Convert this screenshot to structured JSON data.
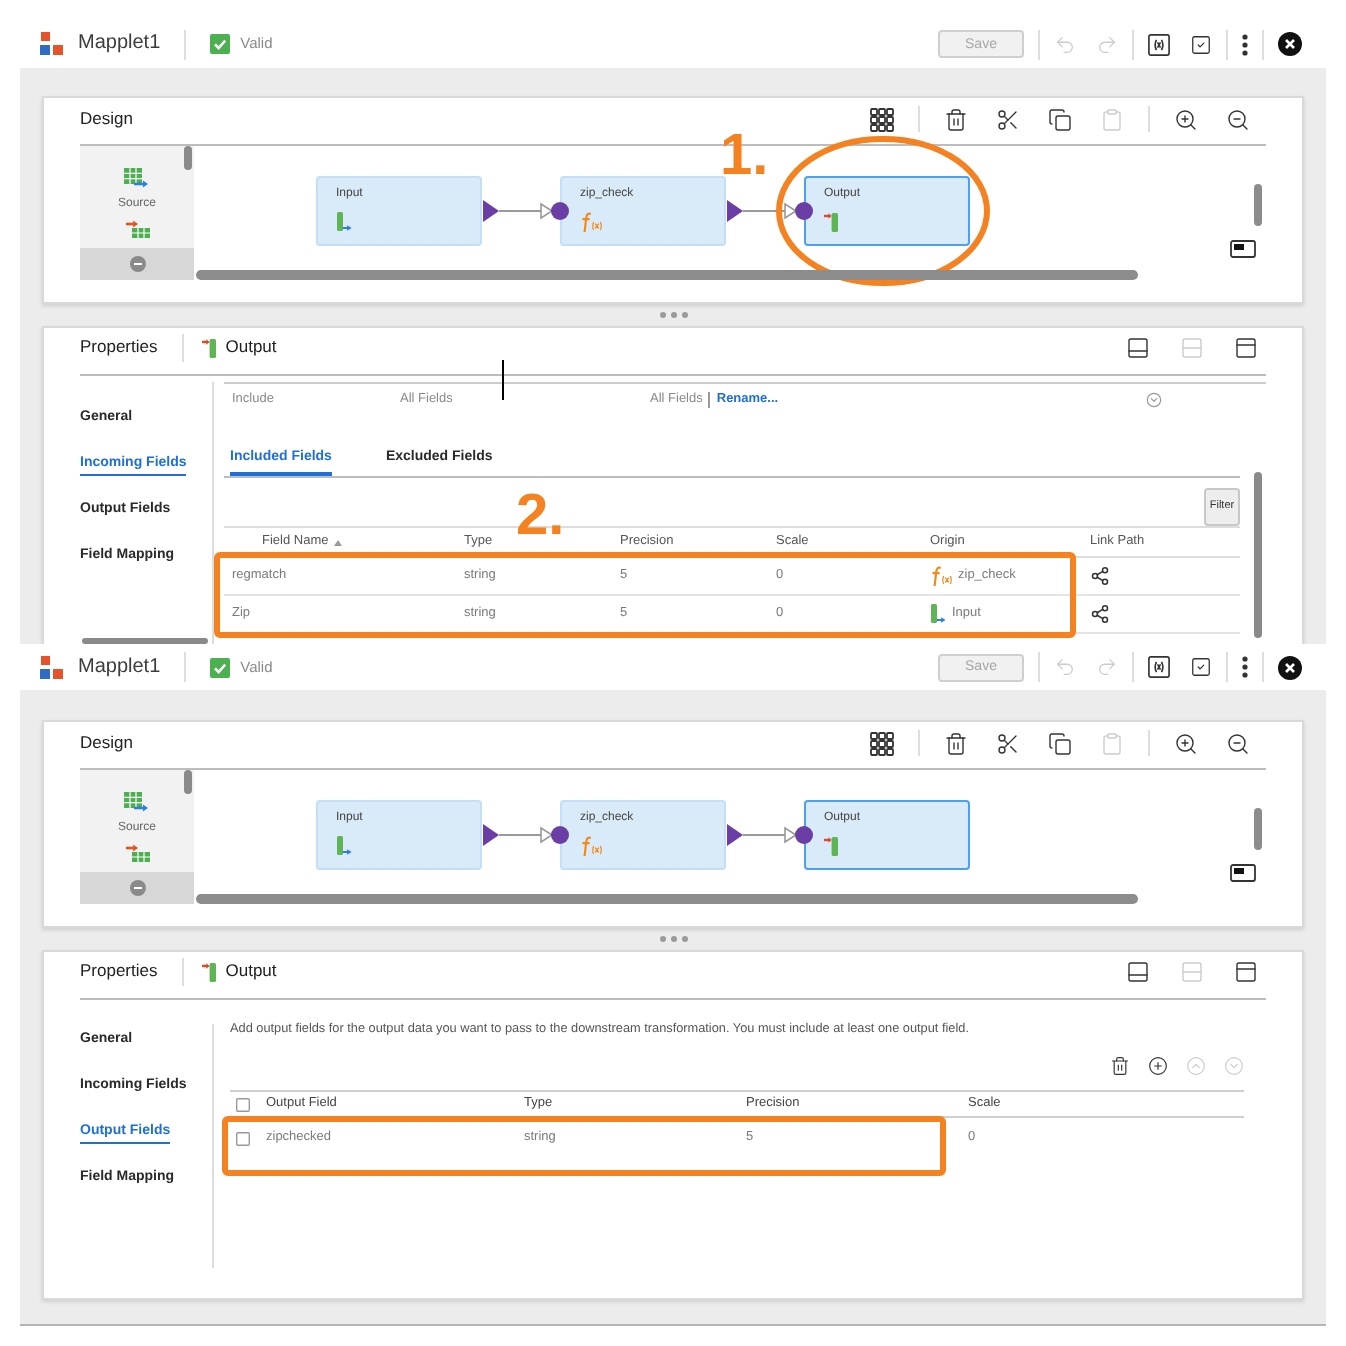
{
  "screens": [
    {
      "header": {
        "title": "Mapplet1",
        "valid": true,
        "status": "Valid",
        "save": {
          "label": "Save",
          "disabled": true
        },
        "actions": [
          [
            {
              "kind": "undo",
              "disabled": true
            },
            {
              "kind": "redo",
              "disabled": true
            }
          ],
          [
            {
              "kind": "parameters",
              "disabled": false
            },
            {
              "kind": "validate",
              "disabled": false
            }
          ],
          [
            {
              "kind": "more",
              "disabled": false
            }
          ],
          [
            {
              "kind": "close",
              "disabled": false
            }
          ]
        ]
      },
      "design": {
        "title": "Design",
        "tools": [
          [
            {
              "kind": "grid",
              "disabled": false
            }
          ],
          [
            {
              "kind": "delete",
              "disabled": false
            },
            {
              "kind": "cut",
              "disabled": false
            },
            {
              "kind": "copy",
              "disabled": false
            },
            {
              "kind": "paste",
              "disabled": true
            }
          ],
          [
            {
              "kind": "zoom_in",
              "disabled": false
            },
            {
              "kind": "zoom_out",
              "disabled": false
            }
          ]
        ],
        "palette": [
          {
            "kind": "source",
            "label": "Source"
          },
          {
            "kind": "target"
          }
        ],
        "nodes": [
          {
            "label": "Input",
            "kind": "input",
            "selected": false,
            "circled": false
          },
          {
            "label": "zip_check",
            "kind": "expression",
            "selected": false,
            "circled": false
          },
          {
            "label": "Output",
            "kind": "output",
            "selected": true,
            "circled": true
          }
        ],
        "callout": "1."
      },
      "properties": {
        "title": "Properties",
        "object": {
          "kind": "output",
          "label": "Output"
        },
        "layout_buttons": [
          {
            "kind": "bottom",
            "disabled": false
          },
          {
            "kind": "split",
            "disabled": true
          },
          {
            "kind": "top",
            "disabled": false
          }
        ],
        "text_cursor": true,
        "nav": [
          {
            "label": "General",
            "selected": false
          },
          {
            "label": "Incoming Fields",
            "selected": true
          },
          {
            "label": "Output Fields",
            "selected": false
          },
          {
            "label": "Field Mapping",
            "selected": false
          }
        ],
        "kind": "incoming_fields",
        "include": {
          "label": "Include",
          "value": "All Fields",
          "summary": "All Fields",
          "link": "Rename..."
        },
        "tabs": [
          {
            "label": "Included Fields",
            "selected": true
          },
          {
            "label": "Excluded Fields",
            "selected": false
          }
        ],
        "filter": "Filter",
        "columns": [
          {
            "label": "Field Name",
            "sorted": true
          },
          {
            "label": "Type",
            "sorted": false
          },
          {
            "label": "Precision",
            "sorted": false
          },
          {
            "label": "Scale",
            "sorted": false
          },
          {
            "label": "Origin",
            "sorted": false
          },
          {
            "label": "Link Path",
            "sorted": false
          }
        ],
        "rows": [
          {
            "name": "regmatch",
            "type": "string",
            "precision": "5",
            "scale": "0",
            "origin": {
              "kind": "expression",
              "label": "zip_check"
            }
          },
          {
            "name": "Zip",
            "type": "string",
            "precision": "5",
            "scale": "0",
            "origin": {
              "kind": "input",
              "label": "Input"
            }
          }
        ],
        "highlight": true,
        "callout": "2."
      }
    },
    {
      "header": {
        "title": "Mapplet1",
        "valid": true,
        "status": "Valid",
        "save": {
          "label": "Save",
          "disabled": true
        },
        "actions": [
          [
            {
              "kind": "undo",
              "disabled": true
            },
            {
              "kind": "redo",
              "disabled": true
            }
          ],
          [
            {
              "kind": "parameters",
              "disabled": false
            },
            {
              "kind": "validate",
              "disabled": false
            }
          ],
          [
            {
              "kind": "more",
              "disabled": false
            }
          ],
          [
            {
              "kind": "close",
              "disabled": false
            }
          ]
        ]
      },
      "design": {
        "title": "Design",
        "tools": [
          [
            {
              "kind": "grid",
              "disabled": false
            }
          ],
          [
            {
              "kind": "delete",
              "disabled": false
            },
            {
              "kind": "cut",
              "disabled": false
            },
            {
              "kind": "copy",
              "disabled": false
            },
            {
              "kind": "paste",
              "disabled": true
            }
          ],
          [
            {
              "kind": "zoom_in",
              "disabled": false
            },
            {
              "kind": "zoom_out",
              "disabled": false
            }
          ]
        ],
        "palette": [
          {
            "kind": "source",
            "label": "Source"
          },
          {
            "kind": "target"
          }
        ],
        "nodes": [
          {
            "label": "Input",
            "kind": "input",
            "selected": false,
            "circled": false
          },
          {
            "label": "zip_check",
            "kind": "expression",
            "selected": false,
            "circled": false
          },
          {
            "label": "Output",
            "kind": "output",
            "selected": true,
            "circled": false
          }
        ]
      },
      "properties": {
        "title": "Properties",
        "object": {
          "kind": "output",
          "label": "Output"
        },
        "layout_buttons": [
          {
            "kind": "bottom",
            "disabled": false
          },
          {
            "kind": "split",
            "disabled": true
          },
          {
            "kind": "top",
            "disabled": false
          }
        ],
        "nav": [
          {
            "label": "General",
            "selected": false
          },
          {
            "label": "Incoming Fields",
            "selected": false
          },
          {
            "label": "Output Fields",
            "selected": true
          },
          {
            "label": "Field Mapping",
            "selected": false
          }
        ],
        "kind": "output_fields",
        "description": "Add output fields for the output data you want to pass to the downstream transformation. You must include at least one output field.",
        "tools": [
          {
            "kind": "delete",
            "disabled": false
          },
          {
            "kind": "add",
            "disabled": false
          },
          {
            "kind": "move_up",
            "disabled": true
          },
          {
            "kind": "move_down",
            "disabled": true
          }
        ],
        "select_all": false,
        "columns": [
          {
            "label": "Output Field"
          },
          {
            "label": "Type"
          },
          {
            "label": "Precision"
          },
          {
            "label": "Scale"
          }
        ],
        "rows": [
          {
            "checked": false,
            "name": "zipchecked",
            "type": "string",
            "precision": "5",
            "scale": "0"
          }
        ],
        "highlight": true
      }
    }
  ]
}
